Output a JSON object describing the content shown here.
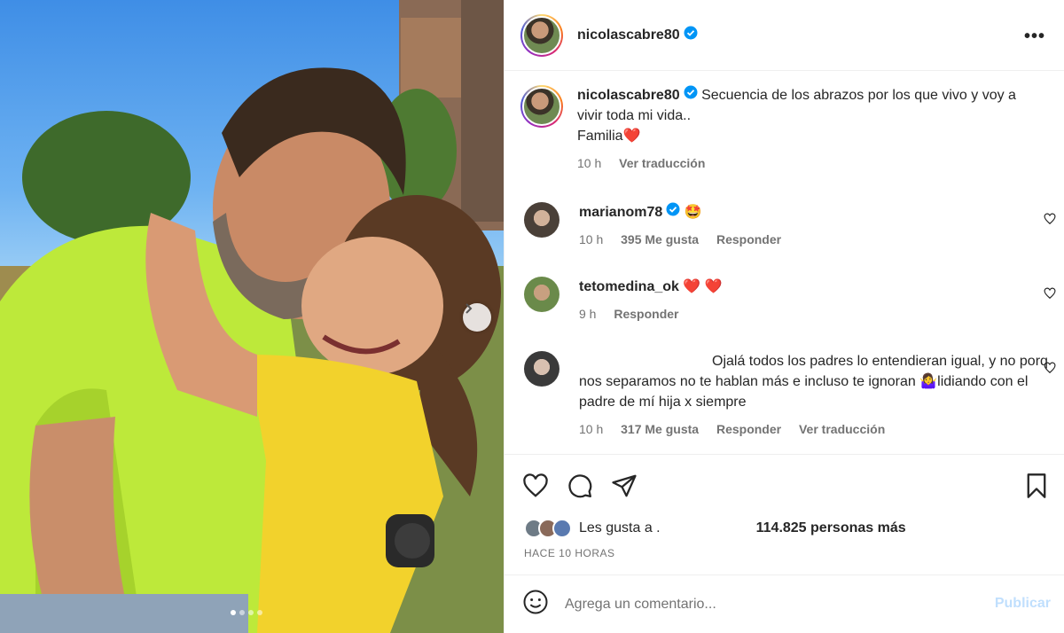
{
  "post": {
    "author": "nicolascabre80",
    "caption": "Secuencia de los abrazos por los que vivo y voy a vivir toda mi vida..",
    "caption_line2": "Familia",
    "caption_time": "10 h",
    "see_translation": "Ver traducción",
    "carousel_dots": 4
  },
  "comments": [
    {
      "user": "marianom78",
      "verified": true,
      "text": "🤩",
      "time": "10 h",
      "likes": "395 Me gusta",
      "reply": "Responder"
    },
    {
      "user": "tetomedina_ok",
      "verified": false,
      "text": "❤️ ❤️",
      "time": "9 h",
      "reply": "Responder"
    },
    {
      "user": "",
      "verified": false,
      "text": "Ojalá todos los padres lo entendieran igual, y no porq nos separamos no te hablan más e incluso te ignoran 🤷‍♀️lidiando con el padre de mí hija x siempre",
      "time": "10 h",
      "likes": "317 Me gusta",
      "reply": "Responder",
      "see_translation": "Ver traducción"
    }
  ],
  "likes": {
    "prefix": "Les gusta a .",
    "count_text": "114.825 personas más"
  },
  "posted_ago": "HACE 10 HORAS",
  "comment_box": {
    "placeholder": "Agrega un comentario...",
    "publish_label": "Publicar"
  },
  "icons": [
    "heart-icon",
    "comment-icon",
    "share-icon",
    "bookmark-icon",
    "emoji-icon",
    "more-icon",
    "chevron-right-icon",
    "verified-icon"
  ],
  "colors": {
    "verified": "#0095f6",
    "publish_disabled": "#c0dffd",
    "secondary_text": "#737373"
  }
}
